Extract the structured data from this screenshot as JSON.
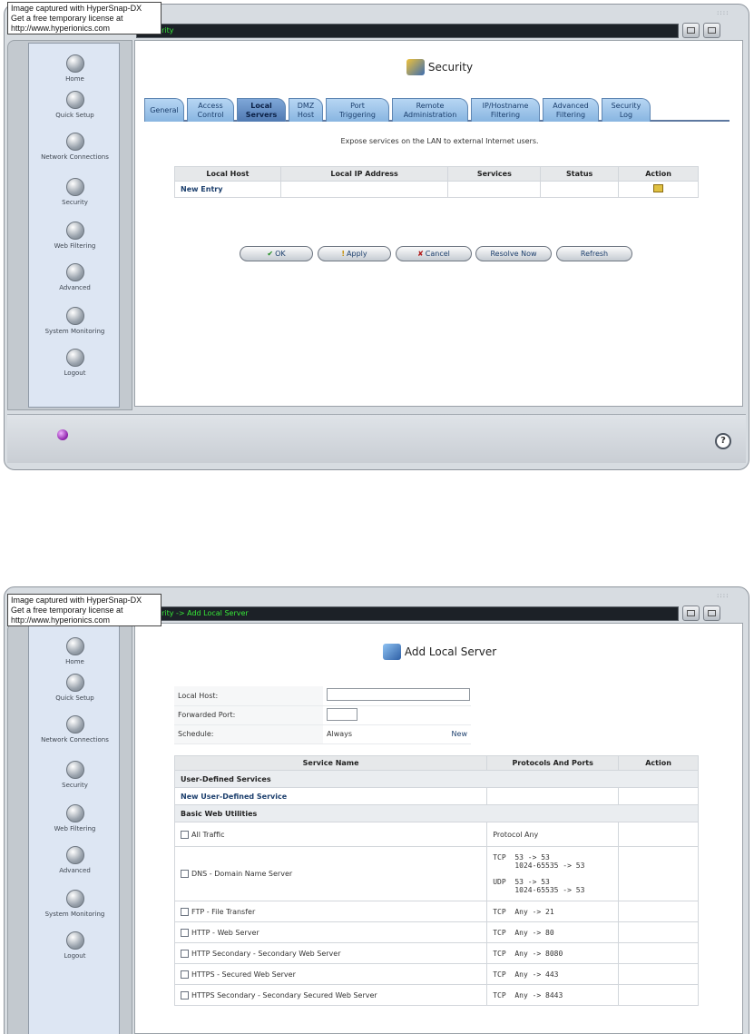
{
  "watermark": {
    "line1": "Image captured with HyperSnap-DX",
    "line2": "Get a free temporary license at",
    "line3": "http://www.hyperionics.com"
  },
  "sidebar": {
    "items": [
      {
        "label": "Home",
        "icon": "home-icon"
      },
      {
        "label": "Quick Setup",
        "icon": "quick-setup-icon"
      },
      {
        "label": "Network Connections",
        "icon": "network-connections-icon"
      },
      {
        "label": "Security",
        "icon": "security-icon"
      },
      {
        "label": "Web Filtering",
        "icon": "web-filtering-icon"
      },
      {
        "label": "Advanced",
        "icon": "advanced-icon"
      },
      {
        "label": "System Monitoring",
        "icon": "system-monitoring-icon"
      },
      {
        "label": "Logout",
        "icon": "logout-icon"
      }
    ]
  },
  "screen1": {
    "breadcrumb": "urity",
    "heading": "Security",
    "tabs": [
      {
        "line1": "General",
        "line2": ""
      },
      {
        "line1": "Access",
        "line2": "Control"
      },
      {
        "line1": "Local",
        "line2": "Servers"
      },
      {
        "line1": "DMZ",
        "line2": "Host"
      },
      {
        "line1": "Port",
        "line2": "Triggering"
      },
      {
        "line1": "Remote",
        "line2": "Administration"
      },
      {
        "line1": "IP/Hostname",
        "line2": "Filtering"
      },
      {
        "line1": "Advanced",
        "line2": "Filtering"
      },
      {
        "line1": "Security",
        "line2": "Log"
      }
    ],
    "active_tab": "Local Servers",
    "description": "Expose services on the LAN to external Internet users.",
    "table": {
      "headers": [
        "Local Host",
        "Local IP Address",
        "Services",
        "Status",
        "Action"
      ],
      "rows": [
        {
          "local_host": "New Entry",
          "local_ip": "",
          "services": "",
          "status": "",
          "action_icon": "new-entry-icon"
        }
      ]
    },
    "buttons": {
      "ok": "OK",
      "apply": "Apply",
      "cancel": "Cancel",
      "resolve_now": "Resolve Now",
      "refresh": "Refresh"
    }
  },
  "screen2": {
    "breadcrumb": "urity -> Add Local Server",
    "heading": "Add Local Server",
    "form": {
      "local_host_label": "Local Host:",
      "local_host_value": "",
      "forwarded_port_label": "Forwarded Port:",
      "forwarded_port_value": "",
      "schedule_label": "Schedule:",
      "schedule_value": "Always",
      "schedule_new": "New"
    },
    "services": {
      "headers": [
        "Service Name",
        "Protocols And Ports",
        "Action"
      ],
      "section_user_defined": "User-Defined Services",
      "new_user_defined": "New User-Defined Service",
      "section_basic": "Basic Web Utilities",
      "rows": [
        {
          "name": "All Traffic",
          "ports": "Protocol Any"
        },
        {
          "name": "DNS - Domain Name Server",
          "ports": "TCP  53 -> 53\n     1024-65535 -> 53\n\nUDP  53 -> 53\n     1024-65535 -> 53"
        },
        {
          "name": "FTP - File Transfer",
          "ports": "TCP  Any -> 21"
        },
        {
          "name": "HTTP - Web Server",
          "ports": "TCP  Any -> 80"
        },
        {
          "name": "HTTP Secondary - Secondary Web Server",
          "ports": "TCP  Any -> 8080"
        },
        {
          "name": "HTTPS - Secured Web Server",
          "ports": "TCP  Any -> 443"
        },
        {
          "name": "HTTPS Secondary - Secondary Secured Web Server",
          "ports": "TCP  Any -> 8443"
        }
      ]
    }
  },
  "colors": {
    "title_bar_text": "#37e837",
    "sidebar_bg": "#dde6f3",
    "tab_active": "#4f79b2",
    "link": "#1c3f6d"
  }
}
